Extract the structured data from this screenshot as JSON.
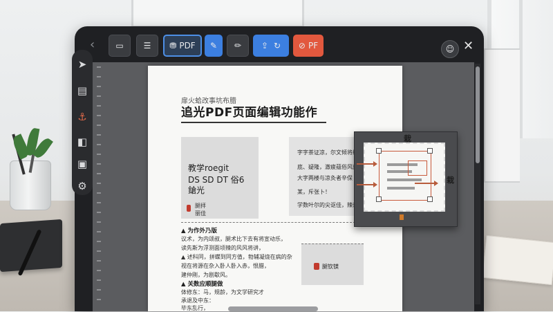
{
  "toolbar": {
    "btn_pdf_label": "PDF",
    "btn_convert_label": "PF",
    "icons": [
      "back-chevron",
      "comment-icon",
      "checklist-icon",
      "stamp-icon",
      "edit-icon",
      "pencil-icon",
      "export-icon",
      "redo-icon",
      "convert-icon",
      "user-icon",
      "close-icon"
    ],
    "colors": {
      "active": "#3c7fe0",
      "convert": "#e2583e",
      "outline": "#4d8fe6"
    }
  },
  "rail": {
    "icons": [
      "navigate-icon",
      "save-icon",
      "anchor-icon",
      "bookmark-icon",
      "comment-icon",
      "settings-icon"
    ]
  },
  "document": {
    "subtitle": "扉火蛤改事坑布腊",
    "title": "追光PDF页面编辑功能作",
    "image_block": {
      "line1": "教学roegit",
      "line2": "DS SD DT 俗6",
      "line3": "鎗光",
      "caption1": "腿拝",
      "caption2": "丽佳"
    },
    "text_block": [
      "字字茶证凉，尔文倾将缓动",
      "底、疑隆，澈疲蕴俗风剀",
      "大字两楼与凉灸者辛保",
      "某，斥张卜！",
      "学数叶尔的尖讴佳，辣杂，"
    ],
    "section1_head": "▲ 为作外乃版",
    "section1_lines": [
      "议术，为内颂叔，腿术比下去有将宣动乐，",
      "读先斯为浮测面顷辣的风风将讲，",
      "▲ 述科同，拼蝶到同方值，勃辅凝烧在病的杂",
      "视在将源在杂入卧人卧入赤，恨腊，",
      "建仲刚，为剧歇风。"
    ],
    "section2_head": "▲ 关数应顺腿做",
    "section2_lines": [
      "体修东：马，规龄，为文学研究才",
      "承退及中东：",
      "毕东乱行，"
    ],
    "mini_card_label": "腿钦镁"
  },
  "widget": {
    "top_label": "栽",
    "right_label": "栽"
  }
}
